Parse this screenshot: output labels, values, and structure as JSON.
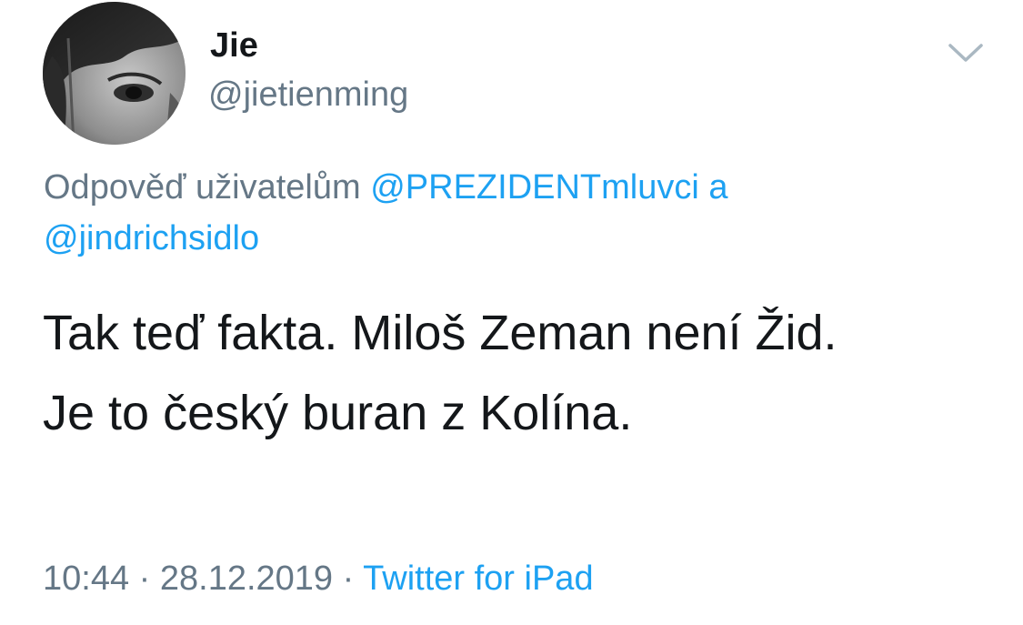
{
  "user": {
    "display_name": "Jie",
    "handle": "@jietienming",
    "avatar_icon": "profile-photo"
  },
  "menu": {
    "icon": "chevron-down-icon"
  },
  "reply": {
    "prefix": "Odpověď uživatelům",
    "mention_1": "@PREZIDENTmluvci",
    "conjunction": "a",
    "mention_2": "@jindrichsidlo"
  },
  "tweet": {
    "line_1": "Tak teď fakta. Miloš Zeman není Žid.",
    "line_2": "Je to český buran z Kolína."
  },
  "meta": {
    "time": "10:44",
    "separator": "·",
    "date": "28.12.2019",
    "source": "Twitter for iPad"
  },
  "colors": {
    "link": "#1da1f2",
    "secondary_text": "#657786",
    "primary_text": "#14171a"
  }
}
